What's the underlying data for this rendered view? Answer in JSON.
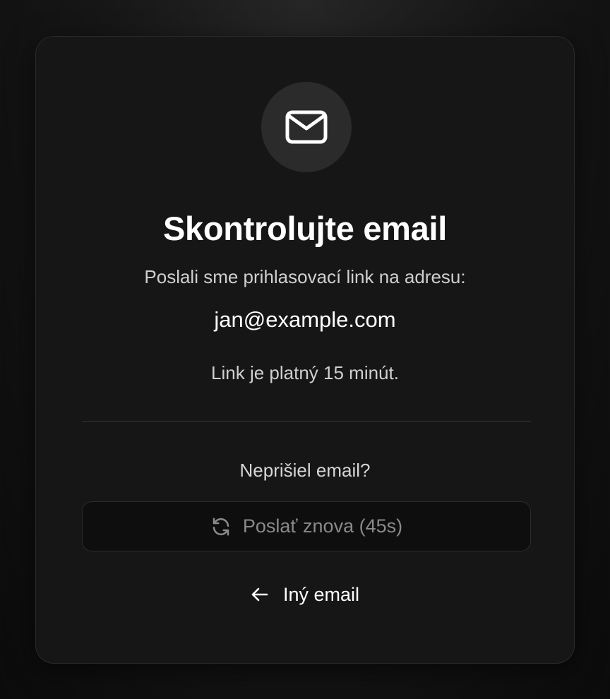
{
  "card": {
    "title": "Skontrolujte email",
    "subtitle": "Poslali sme prihlasovací link na adresu:",
    "email": "jan@example.com",
    "validity": "Link je platný 15 minút.",
    "no_email_prompt": "Neprišiel email?",
    "resend_button": {
      "label": "Poslať znova (45s)",
      "countdown_seconds": 45,
      "disabled": true,
      "icon": "refresh-icon"
    },
    "back_link": {
      "label": "Iný email",
      "icon": "arrow-left-icon"
    },
    "header_icon": "mail-icon"
  },
  "colors": {
    "background": "#0b0b0b",
    "card": "#161616",
    "icon_circle": "#2b2b2b",
    "text_primary": "#ffffff",
    "text_secondary": "#cfcfcf",
    "text_disabled": "#8a8a8a"
  }
}
